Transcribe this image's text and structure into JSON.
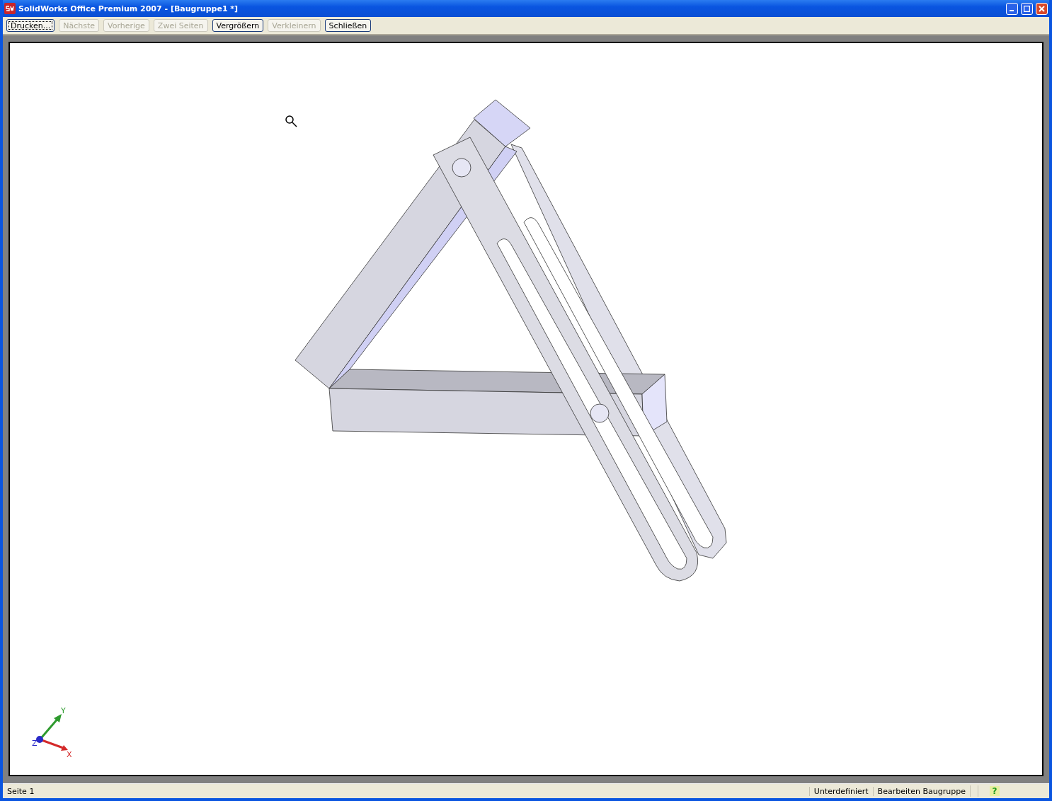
{
  "window": {
    "title": "SolidWorks Office Premium 2007 - [Baugruppe1 *]"
  },
  "toolbar": {
    "buttons": [
      {
        "label": "Drucken...",
        "disabled": false,
        "focused": true
      },
      {
        "label": "Nächste",
        "disabled": true,
        "focused": false
      },
      {
        "label": "Vorherige",
        "disabled": true,
        "focused": false
      },
      {
        "label": "Zwei Seiten",
        "disabled": true,
        "focused": false
      },
      {
        "label": "Vergrößern",
        "disabled": false,
        "focused": false
      },
      {
        "label": "Verkleinern",
        "disabled": true,
        "focused": false
      },
      {
        "label": "Schließen",
        "disabled": false,
        "focused": false
      }
    ]
  },
  "triad": {
    "axes": [
      {
        "label": "X",
        "color": "#d42a2a"
      },
      {
        "label": "Y",
        "color": "#2e9a2e"
      },
      {
        "label": "Z",
        "color": "#2a2ac8"
      }
    ]
  },
  "status_bar": {
    "panes": [
      "Seite 1",
      "Unterdefiniert",
      "Bearbeiten Baugruppe"
    ],
    "help": "?"
  }
}
